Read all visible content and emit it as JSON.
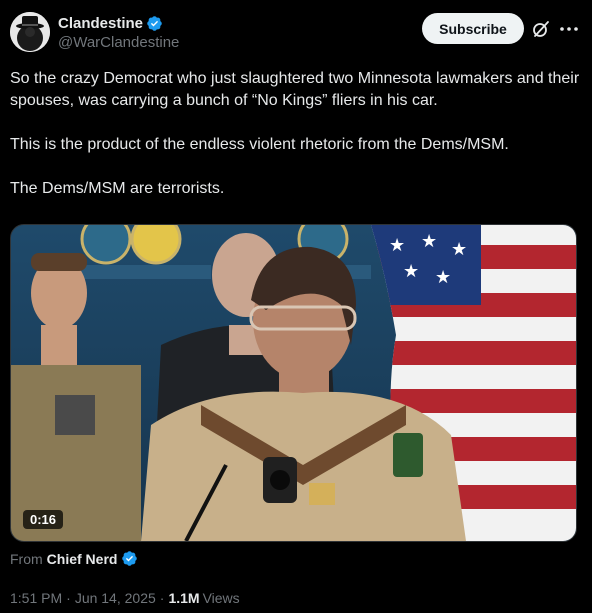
{
  "author": {
    "display_name": "Clandestine",
    "handle": "@WarClandestine",
    "verified": true
  },
  "header": {
    "subscribe_label": "Subscribe",
    "grok_icon": "grok-icon",
    "more_icon": "more-icon"
  },
  "tweet": {
    "paragraphs": [
      "So the crazy Democrat who just slaughtered two Minnesota lawmakers and their spouses, was carrying a bunch of “No Kings” fliers in his car.",
      "This is the product of the endless violent rhetoric from the Dems/MSM.",
      "The Dems/MSM are terrorists."
    ]
  },
  "media": {
    "duration": "0:16"
  },
  "source": {
    "prefix": "From",
    "name": "Chief Nerd",
    "verified": true
  },
  "meta": {
    "time": "1:51 PM",
    "date": "Jun 14, 2025",
    "views_count": "1.1M",
    "views_label": "Views"
  },
  "colors": {
    "background": "#000000",
    "text": "#e7e9ea",
    "secondary_text": "#71767b",
    "verified_blue": "#1d9bf0",
    "subscribe_bg": "#eff3f4"
  }
}
